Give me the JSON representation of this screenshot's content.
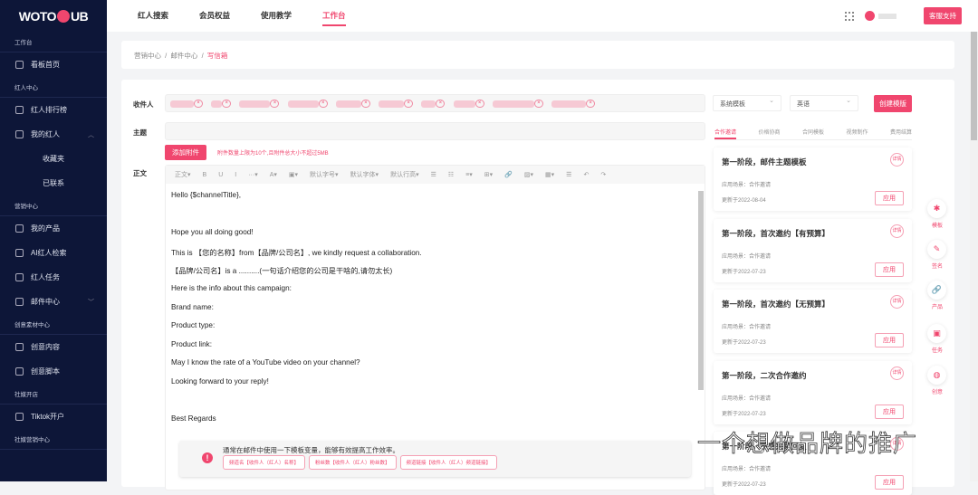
{
  "logo": "WOTOHUB",
  "sidebar": {
    "sections": [
      "工作台",
      "红人中心",
      "营销中心",
      "创意素材中心",
      "社媒开店",
      "社媒营销中心"
    ],
    "items": [
      "看板首页",
      "红人排行榜",
      "我的红人",
      "收藏夹",
      "已联系",
      "我的产品",
      "AI红人检索",
      "红人任务",
      "邮件中心",
      "创意内容",
      "创意脚本",
      "Tiktok开户"
    ]
  },
  "topnav": [
    "红人搜索",
    "会员权益",
    "使用教学",
    "工作台"
  ],
  "support": "客服支持",
  "breadcrumb": [
    "营销中心",
    "邮件中心",
    "写信箱"
  ],
  "form": {
    "recipient_label": "收件人",
    "subject_label": "主题",
    "body_label": "正文",
    "attach_button": "添加附件",
    "attach_hint": "附件数量上限为10个,且附件总大小不超过5MB",
    "toolbar": [
      "正文▾",
      "B",
      "U",
      "I",
      "···▾",
      "A▾",
      "▣▾",
      "默认字号▾",
      "默认字体▾",
      "默认行高▾",
      "☰",
      "☷",
      "≡▾",
      "⊞▾",
      "🔗",
      "▨▾",
      "▦▾",
      "☰",
      "↶",
      "↷"
    ],
    "body_lines": [
      "Hello {$channelTitle},",
      "",
      "Hope you all doing good!",
      "This is 【您的名称】from【品牌/公司名】, we kindly request a collaboration.",
      "【品牌/公司名】is a ..........(一句话介绍您的公司是干啥的,请勿太长)",
      "Here is the info about this campaign:",
      "Brand name:",
      "Product type:",
      "Product link:",
      "May I know the rate of a YouTube video on your channel?",
      "Looking forward to your reply!",
      "",
      "Best Regards"
    ]
  },
  "notice": {
    "text": "通常在邮件中使用一下模板变量，能够有效提高工作效率。",
    "vars": [
      "频道名【收件人（红人）名称】",
      "粉丝数【收件人（红人）粉丝数】",
      "频道链接【收件人（红人）频道链接】"
    ]
  },
  "templates": {
    "select1": "系统模板",
    "select2": "英语",
    "create_button": "创建模版",
    "tabs": [
      "合作邀请",
      "价格协商",
      "合同模板",
      "视频制作",
      "费用结算"
    ],
    "detail": "详情",
    "apply": "应用",
    "cards": [
      {
        "title": "第一阶段，邮件主题模板",
        "scene": "应用场景：合作邀请",
        "updated": "更新于2022-08-04"
      },
      {
        "title": "第一阶段，首次邀约【有预算】",
        "scene": "应用场景：合作邀请",
        "updated": "更新于2022-07-23"
      },
      {
        "title": "第一阶段，首次邀约【无预算】",
        "scene": "应用场景：合作邀请",
        "updated": "更新于2022-07-23"
      },
      {
        "title": "第一阶段，二次合作邀约",
        "scene": "应用场景：合作邀请",
        "updated": "更新于2022-07-23"
      },
      {
        "title": "第一阶段，不感兴趣回复",
        "scene": "应用场景：合作邀请",
        "updated": "更新于2022-07-23"
      }
    ]
  },
  "float": [
    "模板",
    "签名",
    "产品",
    "任务",
    "创意"
  ],
  "watermark": "一个想做品牌的推广",
  "colors": {
    "accent": "#f0466e",
    "sidebar": "#0d1638"
  }
}
